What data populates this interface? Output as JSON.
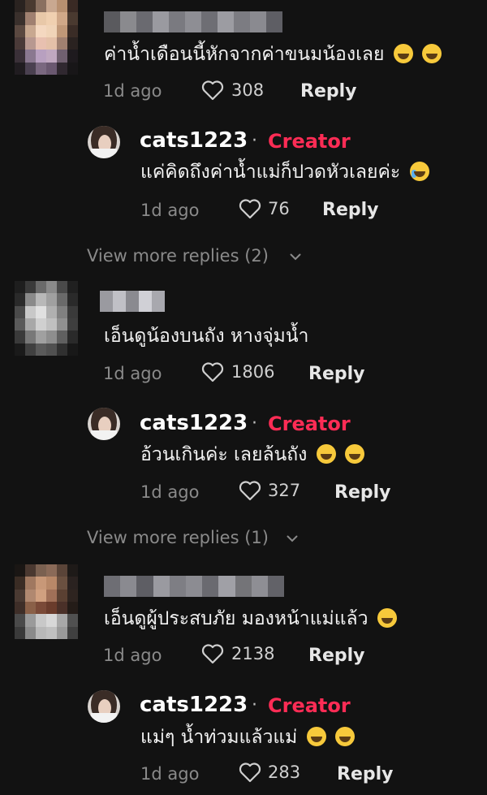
{
  "comments": [
    {
      "text": "ค่าน้ำเดือนนี้หักจากค่าขนมน้องเลย",
      "time": "1d ago",
      "likes": "308",
      "reply_label": "Reply",
      "reply": {
        "username": "cats1223",
        "separator": "·",
        "badge": "Creator",
        "text": "แค่คิดถึงค่าน้ำแม่ก็ปวดหัวเลยค่ะ",
        "time": "1d ago",
        "likes": "76",
        "reply_label": "Reply"
      },
      "view_more": "View more replies (2)"
    },
    {
      "text": "เอ็นดูน้องบนถัง หางจุ่มน้ำ",
      "time": "1d ago",
      "likes": "1806",
      "reply_label": "Reply",
      "reply": {
        "username": "cats1223",
        "separator": "·",
        "badge": "Creator",
        "text": "อ้วนเกินค่ะ เลยล้นถัง",
        "time": "1d ago",
        "likes": "327",
        "reply_label": "Reply"
      },
      "view_more": "View more replies (1)"
    },
    {
      "text": "เอ็นดูผู้ประสบภัย มองหน้าแม่แล้ว",
      "time": "1d ago",
      "likes": "2138",
      "reply_label": "Reply",
      "reply": {
        "username": "cats1223",
        "separator": "·",
        "badge": "Creator",
        "text": "แม่ๆ น้ำท่วมแล้วแม่",
        "time": "1d ago",
        "likes": "283",
        "reply_label": "Reply"
      }
    }
  ],
  "colors": {
    "background": "#121212",
    "creator_badge": "#fe2c55",
    "muted": "#8a8a8a"
  }
}
